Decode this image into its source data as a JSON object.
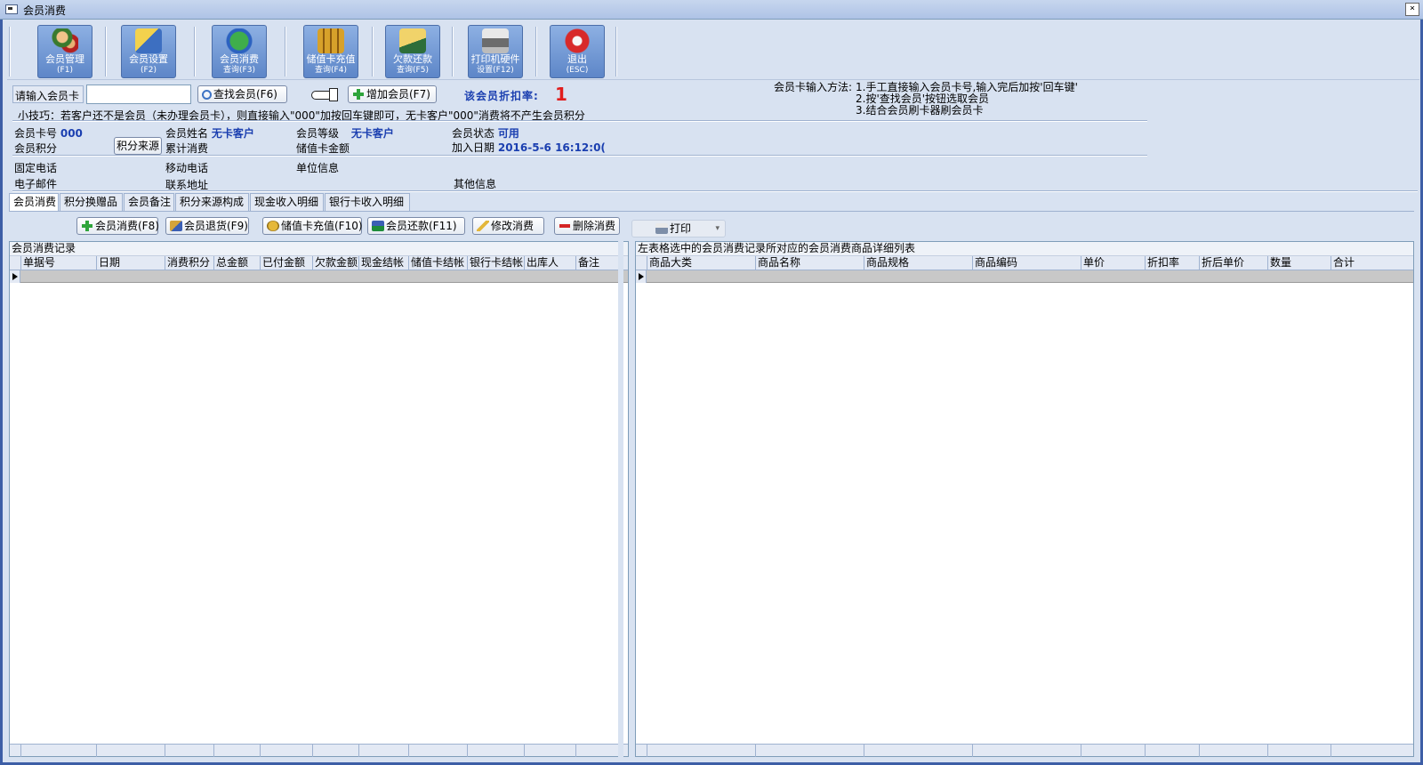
{
  "window": {
    "title": "会员消费",
    "close_glyph": "×"
  },
  "toolbar": [
    {
      "name": "member-manage",
      "l1": "会员管理",
      "l2": "(F1)",
      "icon": "users-icon"
    },
    {
      "name": "member-settings",
      "l1": "会员设置",
      "l2": "(F2)",
      "icon": "settings-icon"
    },
    {
      "name": "consume-query",
      "l1": "会员消费",
      "l2": "查询(F3)",
      "icon": "globe-icon"
    },
    {
      "name": "recharge-query",
      "l1": "储值卡充值",
      "l2": "查询(F4)",
      "icon": "coins-icon"
    },
    {
      "name": "debt-query",
      "l1": "欠款还款",
      "l2": "查询(F5)",
      "icon": "debt-icon"
    },
    {
      "name": "printer-settings",
      "l1": "打印机硬件",
      "l2": "设置(F12)",
      "icon": "printer-icon"
    },
    {
      "name": "exit",
      "l1": "退出",
      "l2": "(ESC)",
      "icon": "power-icon"
    }
  ],
  "card_input": {
    "label": "请输入会员卡",
    "value": "",
    "find_button": "查找会员(F6)",
    "add_button": "增加会员(F7)",
    "discount_label": "该会员折扣率:",
    "discount_value": "1"
  },
  "method": {
    "title": "会员卡输入方法:",
    "lines": [
      "1.手工直接输入会员卡号,输入完后加按'回车键'",
      "2.按'查找会员'按钮选取会员",
      "3.结合会员刷卡器刷会员卡"
    ]
  },
  "tip": "小技巧：若客户还不是会员（未办理会员卡），则直接输入\"000\"加按回车键即可，无卡客户\"000\"消费将不产生会员积分",
  "member": {
    "card_no_label": "会员卡号",
    "card_no": "000",
    "name_label": "会员姓名",
    "name": "无卡客户",
    "level_label": "会员等级",
    "level": "无卡客户",
    "status_label": "会员状态",
    "status": "可用",
    "points_label": "会员积分",
    "points_source_button": "积分来源",
    "total_consume_label": "累计消费",
    "stored_amount_label": "储值卡金额",
    "join_date_label": "加入日期",
    "join_date": "2016-5-6 16:12:0(",
    "phone_label": "固定电话",
    "mobile_label": "移动电话",
    "company_label": "单位信息",
    "email_label": "电子邮件",
    "address_label": "联系地址",
    "other_label": "其他信息"
  },
  "tabs": [
    "会员消费",
    "积分换赠品",
    "会员备注",
    "积分来源构成",
    "现金收入明细",
    "银行卡收入明细"
  ],
  "actions": {
    "consume": "会员消费(F8)",
    "return": "会员退货(F9)",
    "recharge": "储值卡充值(F10)",
    "repay": "会员还款(F11)",
    "edit": "修改消费",
    "delete": "删除消费",
    "print": "打印"
  },
  "left_grid": {
    "title": "会员消费记录",
    "columns": [
      "单据号",
      "日期",
      "消费积分",
      "总金额",
      "已付金额",
      "欠款金额",
      "现金结帐",
      "储值卡结帐",
      "银行卡结帐",
      "出库人",
      "备注"
    ]
  },
  "right_grid": {
    "title": "左表格选中的会员消费记录所对应的会员消费商品详细列表",
    "columns": [
      "商品大类",
      "商品名称",
      "商品规格",
      "商品编码",
      "单价",
      "折扣率",
      "折后单价",
      "数量",
      "合计"
    ]
  }
}
